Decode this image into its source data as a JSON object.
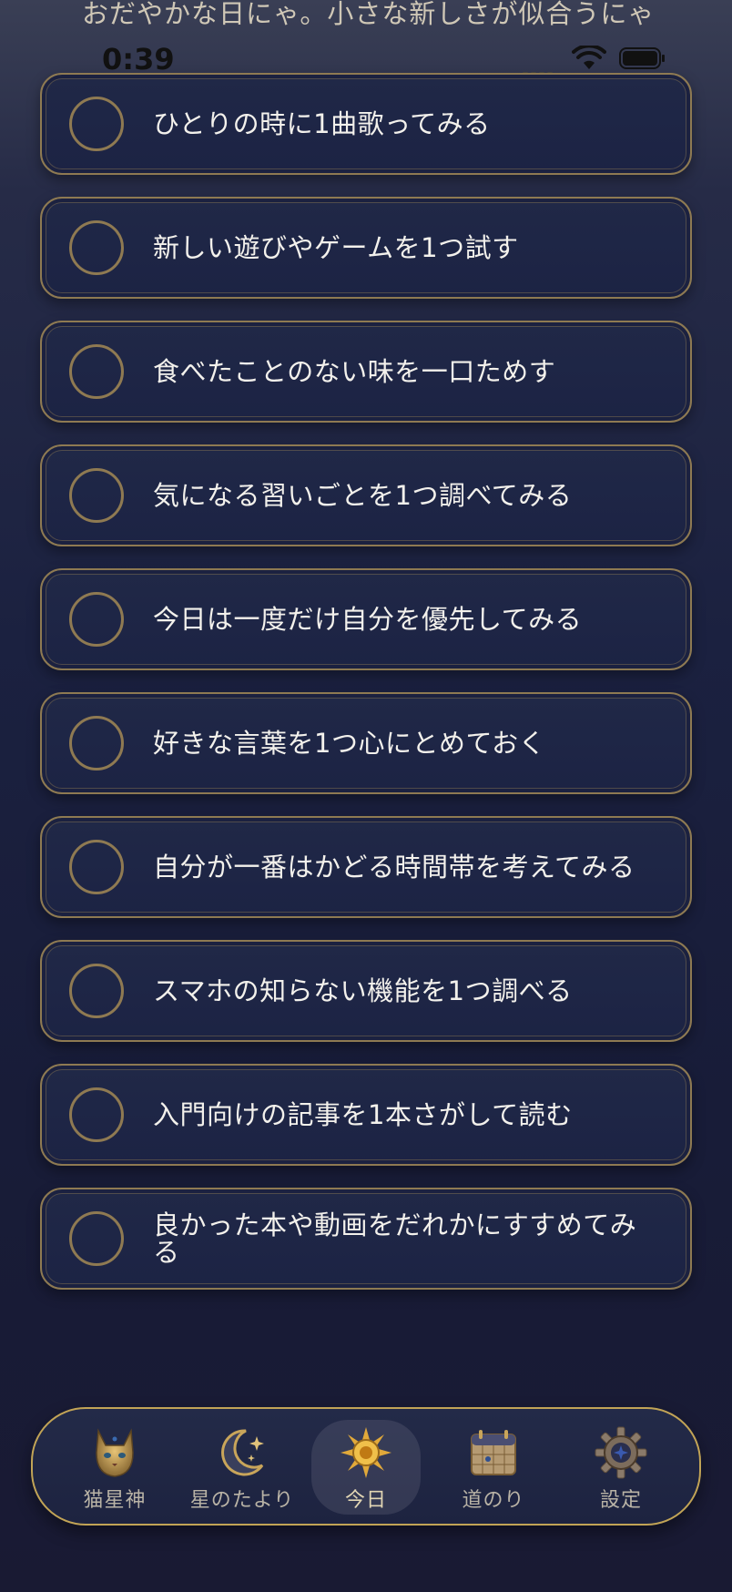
{
  "header": {
    "message": "おだやかな日にゃ。小さな新しさが似合うにゃ"
  },
  "status_bar": {
    "time": "0:39"
  },
  "tasks": [
    {
      "label": "ひとりの時に1曲歌ってみる",
      "checked": false
    },
    {
      "label": "新しい遊びやゲームを1つ試す",
      "checked": false
    },
    {
      "label": "食べたことのない味を一口ためす",
      "checked": false
    },
    {
      "label": "気になる習いごとを1つ調べてみる",
      "checked": false
    },
    {
      "label": "今日は一度だけ自分を優先してみる",
      "checked": false
    },
    {
      "label": "好きな言葉を1つ心にとめておく",
      "checked": false
    },
    {
      "label": "自分が一番はかどる時間帯を考えてみる",
      "checked": false
    },
    {
      "label": "スマホの知らない機能を1つ調べる",
      "checked": false
    },
    {
      "label": "入門向けの記事を1本さがして読む",
      "checked": false
    },
    {
      "label": "良かった本や動画をだれかにすすめてみる",
      "checked": false
    }
  ],
  "tab_bar": {
    "tabs": [
      {
        "label": "猫星神",
        "icon": "cat-icon"
      },
      {
        "label": "星のたより",
        "icon": "crescent-moon-icon"
      },
      {
        "label": "今日",
        "icon": "sun-icon"
      },
      {
        "label": "道のり",
        "icon": "calendar-icon"
      },
      {
        "label": "設定",
        "icon": "gear-icon"
      }
    ],
    "active": "今日"
  },
  "colors": {
    "accent_gold": "#c2a456",
    "card_border": "#8e7a52",
    "background": "#1b2140"
  }
}
